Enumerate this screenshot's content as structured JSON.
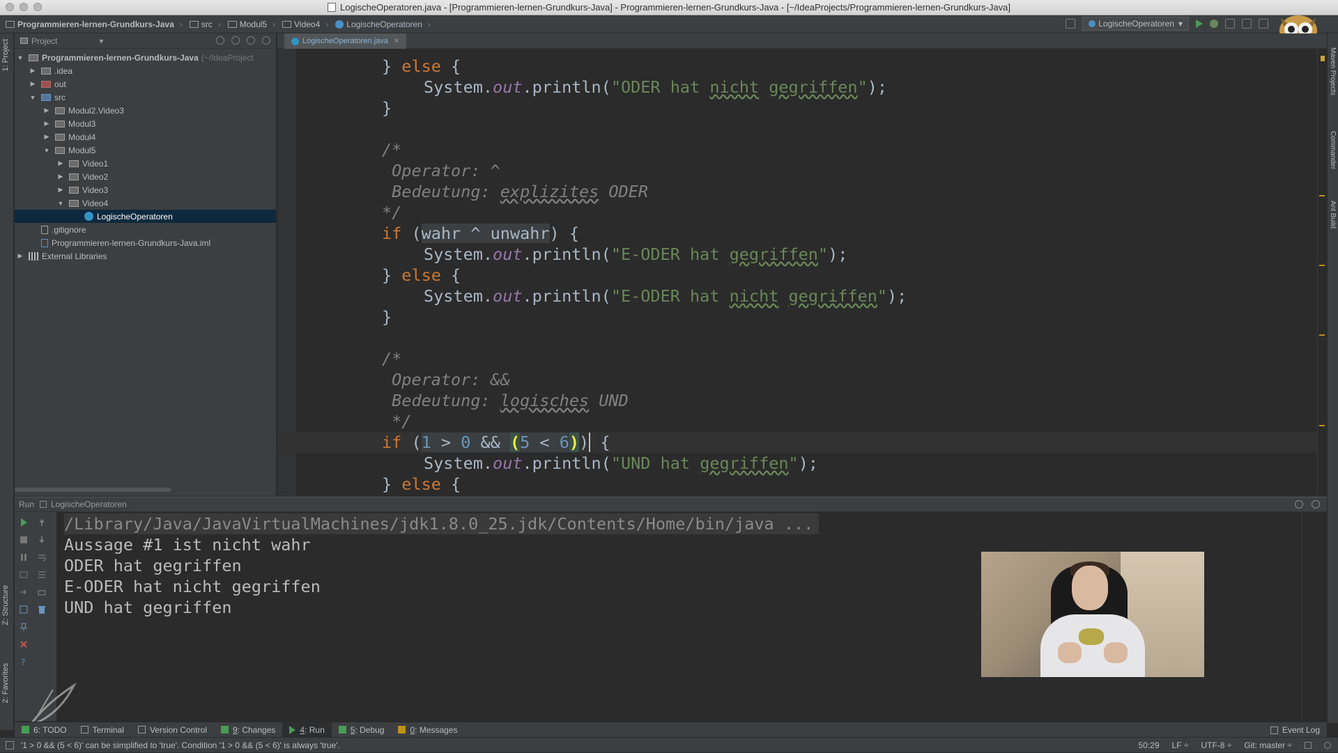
{
  "window": {
    "title": "LogischeOperatoren.java - [Programmieren-lernen-Grundkurs-Java] - Programmieren-lernen-Grundkurs-Java - [~/IdeaProjects/Programmieren-lernen-Grundkurs-Java]"
  },
  "navbar": {
    "crumbs": [
      "Programmieren-lernen-Grundkurs-Java",
      "src",
      "Modul5",
      "Video4",
      "LogischeOperatoren"
    ],
    "run_config": "LogischeOperatoren"
  },
  "left_strip": {
    "project_tab": "1: Project",
    "structure_tab": "Z: Structure",
    "favorites_tab": "2: Favorites"
  },
  "right_strip": {
    "maven_tab": "Maven Projects",
    "commander_tab": "Commander",
    "ant_tab": "Ant Build"
  },
  "project_panel": {
    "header": "Project",
    "tree": [
      {
        "label": "Programmieren-lernen-Grundkurs-Java",
        "suffix": "(~/IdeaProject"
      },
      {
        "label": ".idea"
      },
      {
        "label": "out"
      },
      {
        "label": "src"
      },
      {
        "label": "Modul2.Video3"
      },
      {
        "label": "Modul3"
      },
      {
        "label": "Modul4"
      },
      {
        "label": "Modul5"
      },
      {
        "label": "Video1"
      },
      {
        "label": "Video2"
      },
      {
        "label": "Video3"
      },
      {
        "label": "Video4"
      },
      {
        "label": "LogischeOperatoren"
      },
      {
        "label": ".gitignore"
      },
      {
        "label": "Programmieren-lernen-Grundkurs-Java.iml"
      },
      {
        "label": "External Libraries"
      }
    ]
  },
  "editor": {
    "tab": "LogischeOperatoren.java",
    "lines": {
      "l1": {
        "a": "} ",
        "b": "else",
        "c": " {"
      },
      "l2": {
        "a": "System.",
        "b": "out",
        "c": ".println(",
        "d": "\"ODER hat ",
        "e": "nicht",
        "f": " ",
        "g": "gegriffen",
        "h": "\"",
        "i": ");"
      },
      "l3": {
        "a": "}"
      },
      "l4": {
        "a": "/*"
      },
      "l5": {
        "a": " Operator: ^"
      },
      "l6": {
        "a": " Bedeutung: ",
        "b": "explizites",
        "c": " ODER"
      },
      "l7": {
        "a": "*/"
      },
      "l8": {
        "a": "if",
        "b": " (",
        "c": "wahr ^ unwahr",
        "d": ") {"
      },
      "l9": {
        "a": "System.",
        "b": "out",
        "c": ".println(",
        "d": "\"E-ODER hat ",
        "e": "gegriffen",
        "f": "\"",
        "g": ");"
      },
      "l10": {
        "a": "} ",
        "b": "else",
        "c": " {"
      },
      "l11": {
        "a": "System.",
        "b": "out",
        "c": ".println(",
        "d": "\"E-ODER hat ",
        "e": "nicht",
        "f": " ",
        "g": "gegriffen",
        "h": "\"",
        "i": ");"
      },
      "l12": {
        "a": "}"
      },
      "l13": {
        "a": "/*"
      },
      "l14": {
        "a": " Operator: &&"
      },
      "l15": {
        "a": " Bedeutung: ",
        "b": "logisches",
        "c": " UND"
      },
      "l16": {
        "a": " */"
      },
      "l17": {
        "a": "if",
        "b": " (",
        "c": "1",
        "d": " > ",
        "e": "0",
        "f": " && ",
        "g": "(",
        "h": "5",
        "i": " < ",
        "j": "6",
        "k": ")",
        "l": ")",
        "m": " {"
      },
      "l18": {
        "a": "System.",
        "b": "out",
        "c": ".println(",
        "d": "\"UND hat ",
        "e": "gegriffen",
        "f": "\"",
        "g": ");"
      },
      "l19": {
        "a": "} ",
        "b": "else",
        "c": " {"
      }
    }
  },
  "run_panel": {
    "title": "Run",
    "config": "LogischeOperatoren",
    "output": [
      "/Library/Java/JavaVirtualMachines/jdk1.8.0_25.jdk/Contents/Home/bin/java ...",
      "Aussage #1 ist nicht wahr",
      "ODER hat gegriffen",
      "E-ODER hat nicht gegriffen",
      "UND hat gegriffen"
    ]
  },
  "bottom_bar": {
    "todo": "6: TODO",
    "terminal": "Terminal",
    "vcs": "Version Control",
    "changes_num": "9",
    "changes": ": Changes",
    "run_num": "4",
    "run": ": Run",
    "debug_num": "5",
    "debug": ": Debug",
    "messages_num": "0",
    "messages": ": Messages",
    "event_log": "Event Log"
  },
  "status": {
    "message": "'1 > 0 && (5 < 6)' can be simplified to 'true'. Condition '1 > 0 && (5 < 6)' is always 'true'.",
    "position": "50:29",
    "line_sep": "LF ÷",
    "encoding": "UTF-8 ÷",
    "git": "Git: master ÷"
  },
  "colors": {
    "background": "#2b2b2b",
    "panel": "#3c3f41",
    "keyword": "#cc7832",
    "string": "#6a8759",
    "number": "#6897bb",
    "comment": "#808080",
    "field": "#9876aa"
  }
}
